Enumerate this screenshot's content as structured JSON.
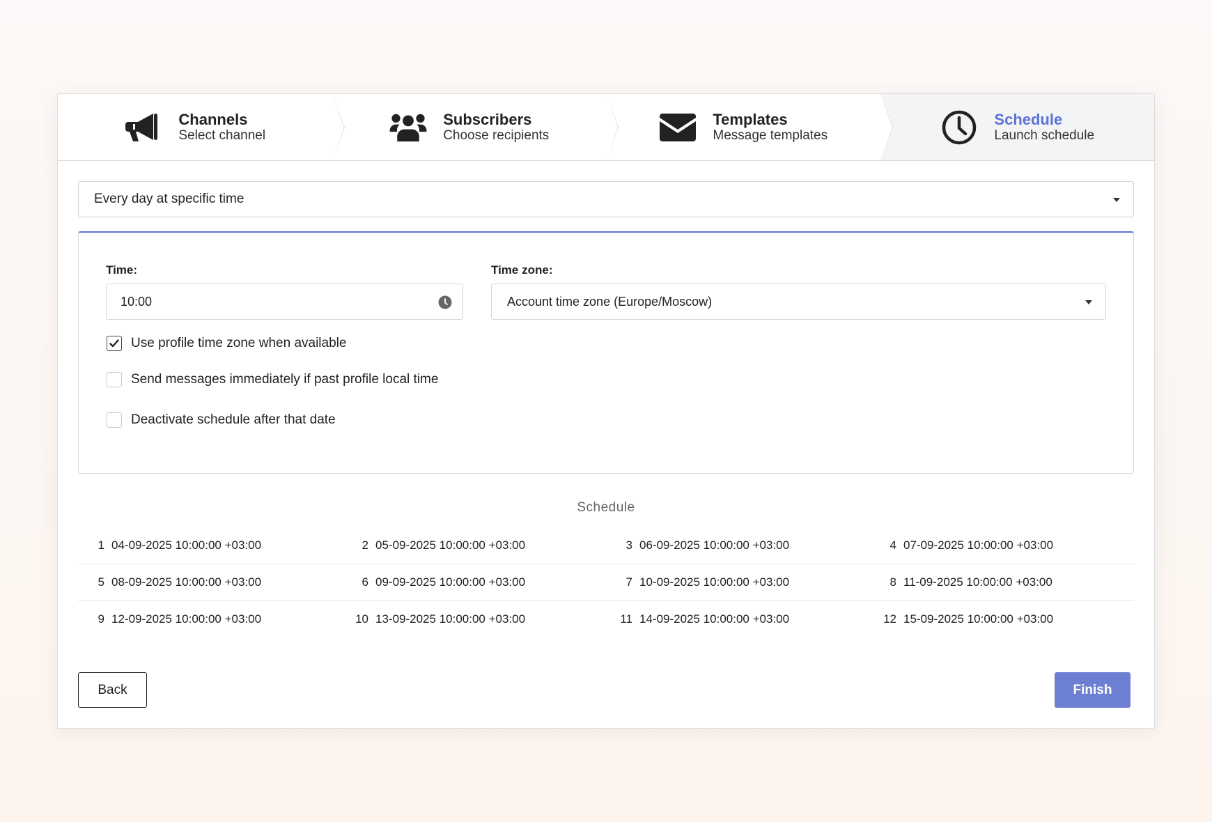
{
  "steps": [
    {
      "title": "Channels",
      "subtitle": "Select channel",
      "icon": "megaphone-icon",
      "active": false
    },
    {
      "title": "Subscribers",
      "subtitle": "Choose recipients",
      "icon": "users-icon",
      "active": false
    },
    {
      "title": "Templates",
      "subtitle": "Message templates",
      "icon": "envelope-icon",
      "active": false
    },
    {
      "title": "Schedule",
      "subtitle": "Launch schedule",
      "icon": "clock-icon",
      "active": true
    }
  ],
  "frequency": {
    "value": "Every day at specific time"
  },
  "settings": {
    "time_label": "Time:",
    "time_value": "10:00",
    "timezone_label": "Time zone:",
    "timezone_value": "Account time zone (Europe/Moscow)",
    "checkboxes": [
      {
        "label": "Use profile time zone when available",
        "checked": true
      },
      {
        "label": "Send messages immediately if past profile local time",
        "checked": false
      },
      {
        "label": "Deactivate schedule after that date",
        "checked": false
      }
    ]
  },
  "schedule": {
    "title": "Schedule",
    "entries": [
      {
        "num": "1",
        "datetime": "04-09-2025 10:00:00 +03:00"
      },
      {
        "num": "2",
        "datetime": "05-09-2025 10:00:00 +03:00"
      },
      {
        "num": "3",
        "datetime": "06-09-2025 10:00:00 +03:00"
      },
      {
        "num": "4",
        "datetime": "07-09-2025 10:00:00 +03:00"
      },
      {
        "num": "5",
        "datetime": "08-09-2025 10:00:00 +03:00"
      },
      {
        "num": "6",
        "datetime": "09-09-2025 10:00:00 +03:00"
      },
      {
        "num": "7",
        "datetime": "10-09-2025 10:00:00 +03:00"
      },
      {
        "num": "8",
        "datetime": "11-09-2025 10:00:00 +03:00"
      },
      {
        "num": "9",
        "datetime": "12-09-2025 10:00:00 +03:00"
      },
      {
        "num": "10",
        "datetime": "13-09-2025 10:00:00 +03:00"
      },
      {
        "num": "11",
        "datetime": "14-09-2025 10:00:00 +03:00"
      },
      {
        "num": "12",
        "datetime": "15-09-2025 10:00:00 +03:00"
      }
    ]
  },
  "buttons": {
    "back": "Back",
    "finish": "Finish"
  },
  "colors": {
    "accent": "#5b72d6",
    "finish_button": "#6c7fd3",
    "active_step_bg": "#f3f4f6"
  }
}
